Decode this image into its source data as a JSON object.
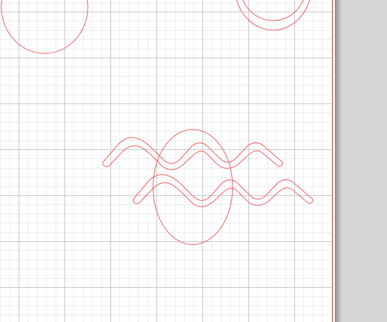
{
  "colors": {
    "workspace_background": "#d6d6d6",
    "paper": "#ffffff",
    "grid_minor": "#ececec",
    "grid_major": "#c6c6c6",
    "cut_line": "#f05a5a",
    "page_border": "#e03c3c"
  },
  "shapes": [
    {
      "name": "oval-shape",
      "kind": "ellipse"
    },
    {
      "name": "double-oval-shape",
      "kind": "ellipse-pair"
    },
    {
      "name": "large-oval-shape",
      "kind": "ellipse"
    },
    {
      "name": "wave-band-upper",
      "kind": "wave"
    },
    {
      "name": "wave-band-lower",
      "kind": "wave"
    }
  ]
}
